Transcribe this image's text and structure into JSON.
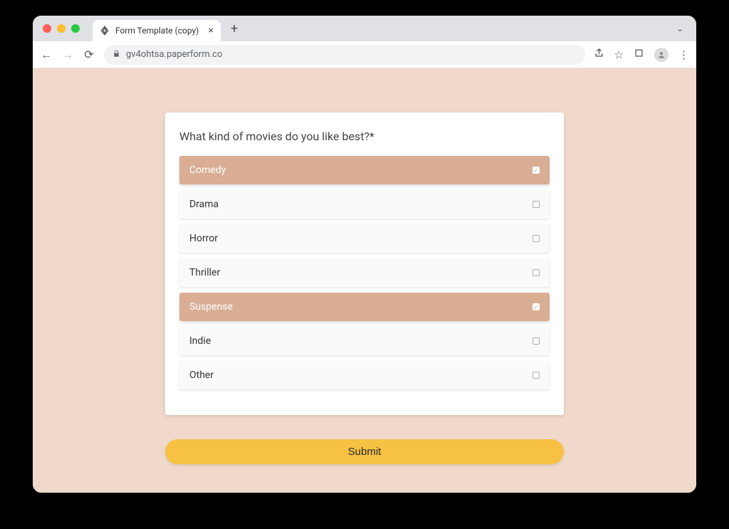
{
  "browser": {
    "tab_title": "Form Template (copy)",
    "url": "gv4ohtsa.paperform.co"
  },
  "form": {
    "question": "What kind of movies do you like best?*",
    "options": [
      {
        "label": "Comedy",
        "selected": true
      },
      {
        "label": "Drama",
        "selected": false
      },
      {
        "label": "Horror",
        "selected": false
      },
      {
        "label": "Thriller",
        "selected": false
      },
      {
        "label": "Suspense",
        "selected": true
      },
      {
        "label": "Indie",
        "selected": false
      },
      {
        "label": "Other",
        "selected": false
      }
    ],
    "submit_label": "Submit"
  }
}
